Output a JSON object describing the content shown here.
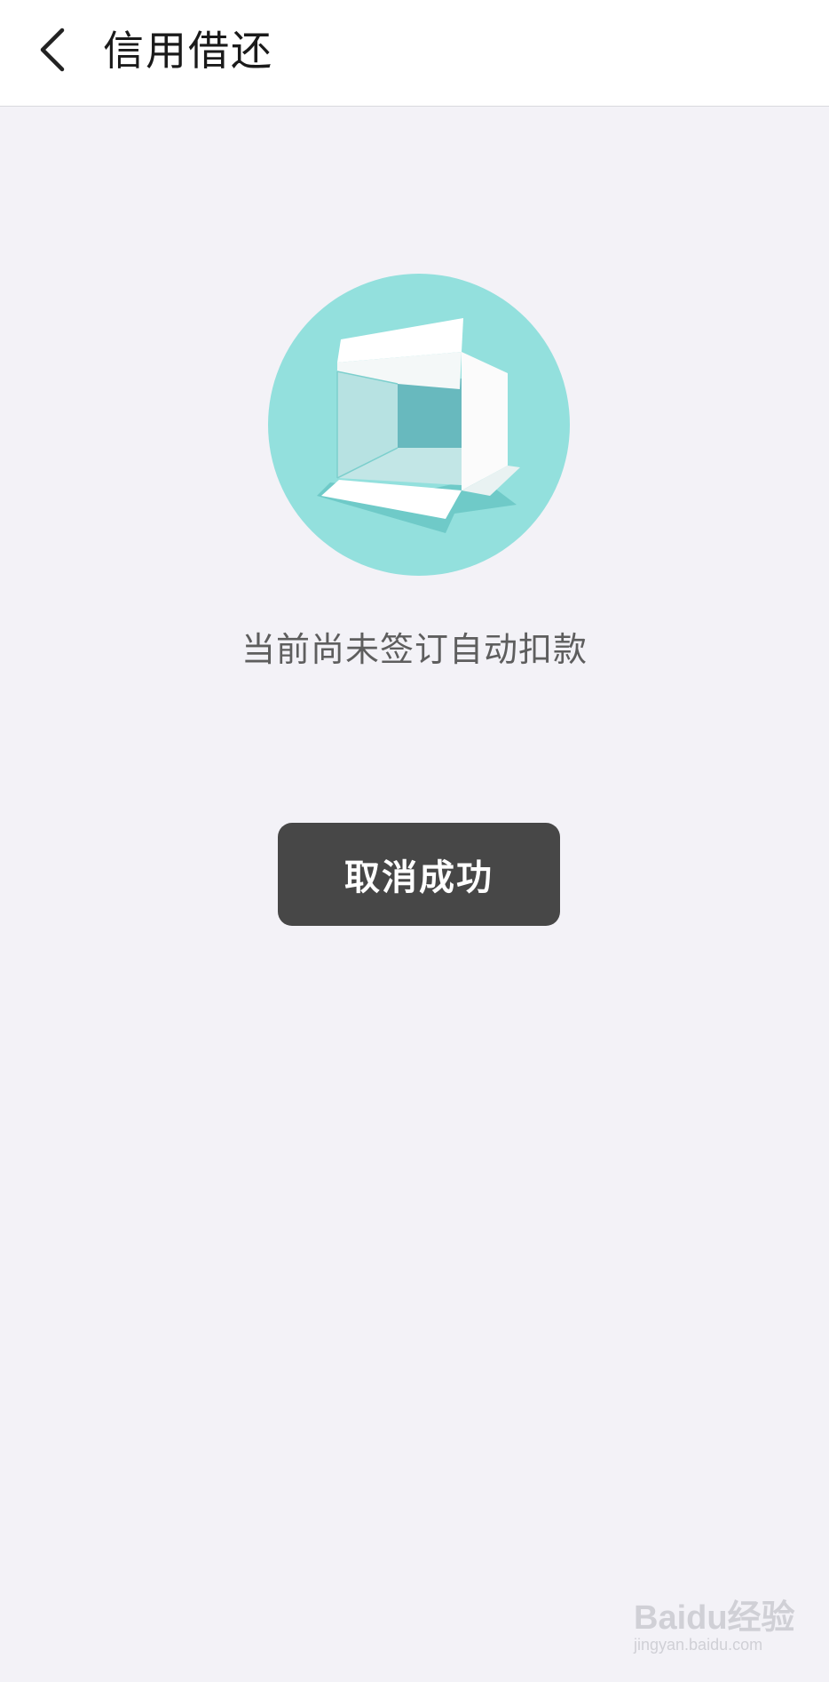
{
  "header": {
    "back_icon": "chevron-left-icon",
    "title": "信用借还"
  },
  "main": {
    "illustration_icon": "empty-box-icon",
    "empty_text": "当前尚未签订自动扣款"
  },
  "toast": {
    "text": "取消成功"
  },
  "watermark": {
    "logo": "Baidu经验",
    "url": "jingyan.baidu.com"
  },
  "colors": {
    "background": "#f3f2f7",
    "header_bg": "#ffffff",
    "illustration_circle": "#93e0dd",
    "illustration_inner_dark": "#68b9be",
    "illustration_inner_light": "#b7e2e2",
    "toast_bg": "#474747",
    "text_secondary": "#5e5e5e"
  }
}
